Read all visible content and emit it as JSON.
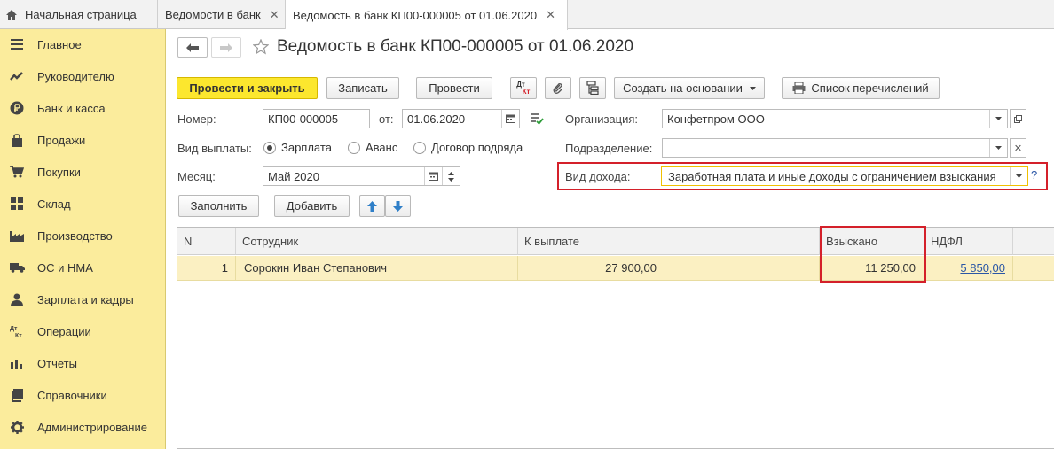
{
  "tabs": {
    "home": "Начальная страница",
    "list": "Ведомости в банк",
    "doc": "Ведомость в банк КП00-000005 от 01.06.2020",
    "close_glyph": "✕"
  },
  "sidebar": {
    "items": [
      {
        "label": "Главное",
        "icon": "menu-icon"
      },
      {
        "label": "Руководителю",
        "icon": "trend-icon"
      },
      {
        "label": "Банк и касса",
        "icon": "ruble-icon"
      },
      {
        "label": "Продажи",
        "icon": "bag-icon"
      },
      {
        "label": "Покупки",
        "icon": "cart-icon"
      },
      {
        "label": "Склад",
        "icon": "grid-icon"
      },
      {
        "label": "Производство",
        "icon": "factory-icon"
      },
      {
        "label": "ОС и НМА",
        "icon": "truck-icon"
      },
      {
        "label": "Зарплата и кадры",
        "icon": "person-icon"
      },
      {
        "label": "Операции",
        "icon": "dtkt-icon"
      },
      {
        "label": "Отчеты",
        "icon": "bars-icon"
      },
      {
        "label": "Справочники",
        "icon": "book-icon"
      },
      {
        "label": "Администрирование",
        "icon": "gear-icon"
      }
    ]
  },
  "header": {
    "title": "Ведомость в банк КП00-000005 от 01.06.2020"
  },
  "toolbar": {
    "post_close": "Провести и закрыть",
    "save": "Записать",
    "post": "Провести",
    "dtkt_top": "Дт",
    "dtkt_bottom": "Кт",
    "create_based": "Создать на основании",
    "transfers_list": "Список перечислений"
  },
  "form": {
    "number_label": "Номер:",
    "number_value": "КП00-000005",
    "date_label": "от:",
    "date_value": "01.06.2020",
    "org_label": "Организация:",
    "org_value": "Конфетпром ООО",
    "payment_type_label": "Вид выплаты:",
    "payment_options": [
      "Зарплата",
      "Аванс",
      "Договор подряда"
    ],
    "payment_selected": "Зарплата",
    "division_label": "Подразделение:",
    "division_value": "",
    "month_label": "Месяц:",
    "month_value": "Май 2020",
    "income_type_label": "Вид дохода:",
    "income_type_value": "Заработная плата и иные доходы с ограничением взыскания",
    "help": "?",
    "fill_button": "Заполнить",
    "add_button": "Добавить"
  },
  "table": {
    "columns": [
      "N",
      "Сотрудник",
      "К выплате",
      "Взыскано",
      "НДФЛ"
    ],
    "rows": [
      {
        "n": "1",
        "employee": "Сорокин Иван Степанович",
        "to_pay": "27 900,00",
        "withheld": "11 250,00",
        "ndfl": "5 850,00"
      }
    ]
  },
  "colors": {
    "sidebar_bg": "#fbec9c",
    "primary_button": "#fce72e",
    "highlight_border": "#d4202a",
    "selected_row": "#fbf0c2",
    "link": "#2a56a6"
  }
}
